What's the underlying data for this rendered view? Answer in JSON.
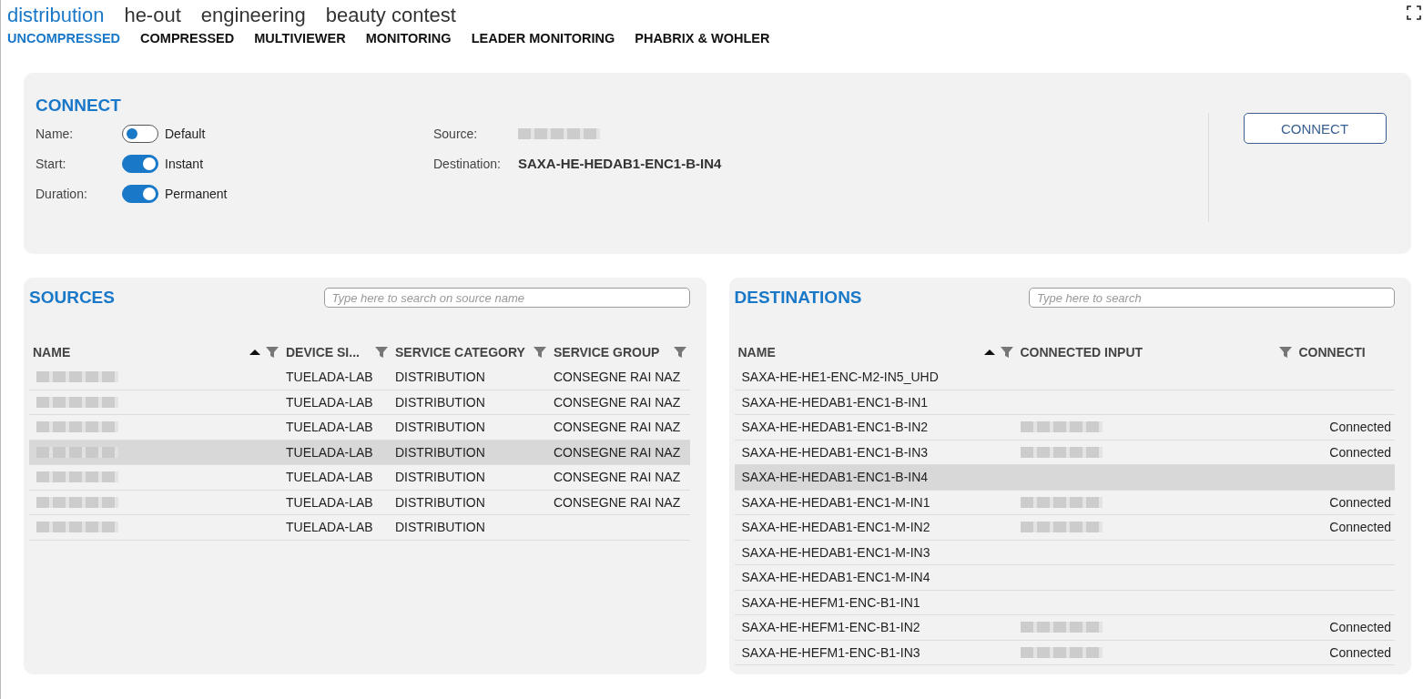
{
  "top_tabs": [
    {
      "label": "distribution",
      "selected": true
    },
    {
      "label": "he-out",
      "selected": false
    },
    {
      "label": "engineering",
      "selected": false
    },
    {
      "label": "beauty contest",
      "selected": false
    }
  ],
  "sub_tabs": [
    {
      "label": "UNCOMPRESSED",
      "selected": true
    },
    {
      "label": "COMPRESSED",
      "selected": false
    },
    {
      "label": "MULTIVIEWER",
      "selected": false
    },
    {
      "label": "MONITORING",
      "selected": false
    },
    {
      "label": "LEADER MONITORING",
      "selected": false
    },
    {
      "label": "PHABRIX & WOHLER",
      "selected": false
    }
  ],
  "connect": {
    "title": "CONNECT",
    "options": [
      {
        "label": "Name:",
        "on": false,
        "value": "Default"
      },
      {
        "label": "Start:",
        "on": true,
        "value": "Instant"
      },
      {
        "label": "Duration:",
        "on": true,
        "value": "Permanent"
      }
    ],
    "source": {
      "label": "Source:",
      "redacted": true
    },
    "destination": {
      "label": "Destination:",
      "value": "SAXA-HE-HEDAB1-ENC1-B-IN4"
    },
    "button": "CONNECT"
  },
  "sources": {
    "title": "SOURCES",
    "search": {
      "placeholder": "Type here to search on source name"
    },
    "columns": [
      {
        "label": "NAME",
        "sorted": true
      },
      {
        "label": "DEVICE SI...",
        "sorted": false
      },
      {
        "label": "SERVICE CATEGORY",
        "sorted": false
      },
      {
        "label": "SERVICE GROUP",
        "sorted": false
      }
    ],
    "rows": [
      {
        "name_redacted": true,
        "device_site": "TUELADA-LAB",
        "service_category": "DISTRIBUTION",
        "service_group": "CONSEGNE RAI NAZ",
        "selected": false
      },
      {
        "name_redacted": true,
        "device_site": "TUELADA-LAB",
        "service_category": "DISTRIBUTION",
        "service_group": "CONSEGNE RAI NAZ",
        "selected": false
      },
      {
        "name_redacted": true,
        "device_site": "TUELADA-LAB",
        "service_category": "DISTRIBUTION",
        "service_group": "CONSEGNE RAI NAZ",
        "selected": false
      },
      {
        "name_redacted": true,
        "device_site": "TUELADA-LAB",
        "service_category": "DISTRIBUTION",
        "service_group": "CONSEGNE RAI NAZ",
        "selected": true
      },
      {
        "name_redacted": true,
        "device_site": "TUELADA-LAB",
        "service_category": "DISTRIBUTION",
        "service_group": "CONSEGNE RAI NAZ",
        "selected": false
      },
      {
        "name_redacted": true,
        "device_site": "TUELADA-LAB",
        "service_category": "DISTRIBUTION",
        "service_group": "CONSEGNE RAI NAZ",
        "selected": false
      },
      {
        "name_redacted": true,
        "device_site": "TUELADA-LAB",
        "service_category": "DISTRIBUTION",
        "selected": false
      }
    ]
  },
  "destinations": {
    "title": "DESTINATIONS",
    "search": {
      "placeholder": "Type here to search"
    },
    "columns": [
      {
        "label": "NAME",
        "sorted": true
      },
      {
        "label": "CONNECTED INPUT",
        "sorted": false
      },
      {
        "label": "CONNECTI",
        "sorted": false
      }
    ],
    "rows": [
      {
        "name": "SAXA-HE-HE1-ENC-M2-IN5_UHD",
        "input_redacted": false,
        "selected": false
      },
      {
        "name": "SAXA-HE-HEDAB1-ENC1-B-IN1",
        "input_redacted": false,
        "selected": false
      },
      {
        "name": "SAXA-HE-HEDAB1-ENC1-B-IN2",
        "input_redacted": true,
        "status": "Connected",
        "selected": false
      },
      {
        "name": "SAXA-HE-HEDAB1-ENC1-B-IN3",
        "input_redacted": true,
        "status": "Connected",
        "selected": false
      },
      {
        "name": "SAXA-HE-HEDAB1-ENC1-B-IN4",
        "input_redacted": false,
        "selected": true
      },
      {
        "name": "SAXA-HE-HEDAB1-ENC1-M-IN1",
        "input_redacted": true,
        "status": "Connected",
        "selected": false
      },
      {
        "name": "SAXA-HE-HEDAB1-ENC1-M-IN2",
        "input_redacted": true,
        "status": "Connected",
        "selected": false
      },
      {
        "name": "SAXA-HE-HEDAB1-ENC1-M-IN3",
        "input_redacted": false,
        "selected": false
      },
      {
        "name": "SAXA-HE-HEDAB1-ENC1-M-IN4",
        "input_redacted": false,
        "selected": false
      },
      {
        "name": "SAXA-HE-HEFM1-ENC-B1-IN1",
        "input_redacted": false,
        "selected": false
      },
      {
        "name": "SAXA-HE-HEFM1-ENC-B1-IN2",
        "input_redacted": true,
        "status": "Connected",
        "selected": false
      },
      {
        "name": "SAXA-HE-HEFM1-ENC-B1-IN3",
        "input_redacted": true,
        "status": "Connected",
        "selected": false
      }
    ]
  }
}
